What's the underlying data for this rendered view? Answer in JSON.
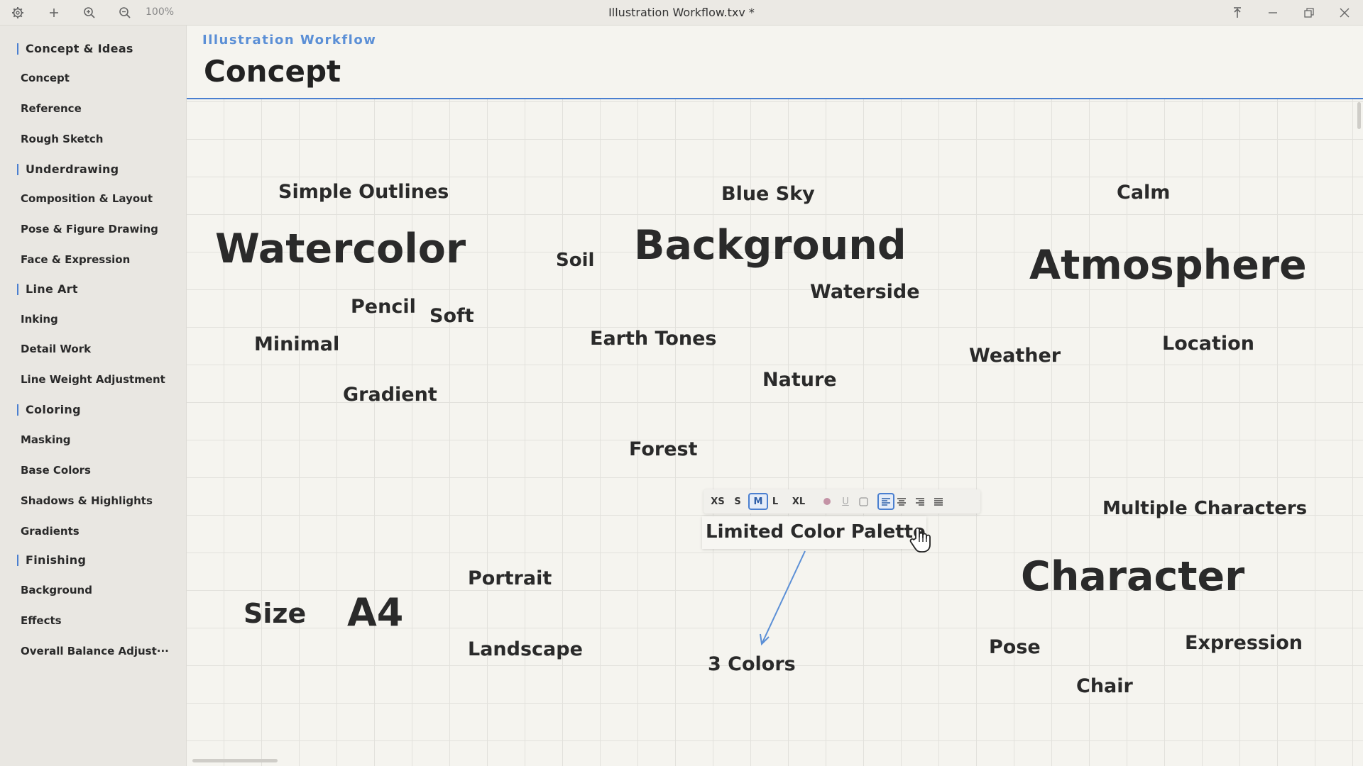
{
  "titlebar": {
    "zoom": "100%",
    "title": "Illustration Workflow.txv *",
    "icons": [
      "gear-icon",
      "plus-icon",
      "zoom-in-icon",
      "zoom-out-icon",
      "pin-icon",
      "minimize-icon",
      "restore-icon",
      "close-icon"
    ]
  },
  "sidebar": {
    "sections": [
      {
        "label": "Concept & Ideas",
        "items": [
          "Concept",
          "Reference",
          "Rough Sketch"
        ]
      },
      {
        "label": "Underdrawing",
        "items": [
          "Composition & Layout",
          "Pose & Figure Drawing",
          "Face & Expression"
        ]
      },
      {
        "label": "Line Art",
        "items": [
          "Inking",
          "Detail Work",
          "Line Weight Adjustment"
        ]
      },
      {
        "label": "Coloring",
        "items": [
          "Masking",
          "Base Colors",
          "Shadows & Highlights",
          "Gradients"
        ]
      },
      {
        "label": "Finishing",
        "items": [
          "Background",
          "Effects",
          "Overall Balance Adjust···"
        ]
      }
    ],
    "accent_color": "#4a7fd0"
  },
  "header": {
    "doc_title": "Illustration Workflow",
    "page_title": "Concept"
  },
  "canvas": {
    "words": [
      "Simple Outlines",
      "Blue Sky",
      "Calm",
      "Watercolor",
      "Soil",
      "Background",
      "Atmosphere",
      "Waterside",
      "Pencil",
      "Soft",
      "Minimal",
      "Earth Tones",
      "Weather",
      "Location",
      "Nature",
      "Gradient",
      "Forest",
      "Multiple Characters",
      "Limited Color Palette",
      "Portrait",
      "Character",
      "Size",
      "A4",
      "Landscape",
      "3 Colors",
      "Pose",
      "Expression",
      "Chair"
    ],
    "selected_word": "Limited Color Palette",
    "toolbar": {
      "sizes": [
        "XS",
        "S",
        "M",
        "L",
        "XL"
      ],
      "active_size": "M",
      "icons": [
        "color-dot-icon",
        "underline-icon",
        "border-box-icon",
        "align-left-icon",
        "align-center-icon",
        "align-right-icon",
        "align-justify-icon"
      ],
      "underline_label": "U"
    }
  }
}
